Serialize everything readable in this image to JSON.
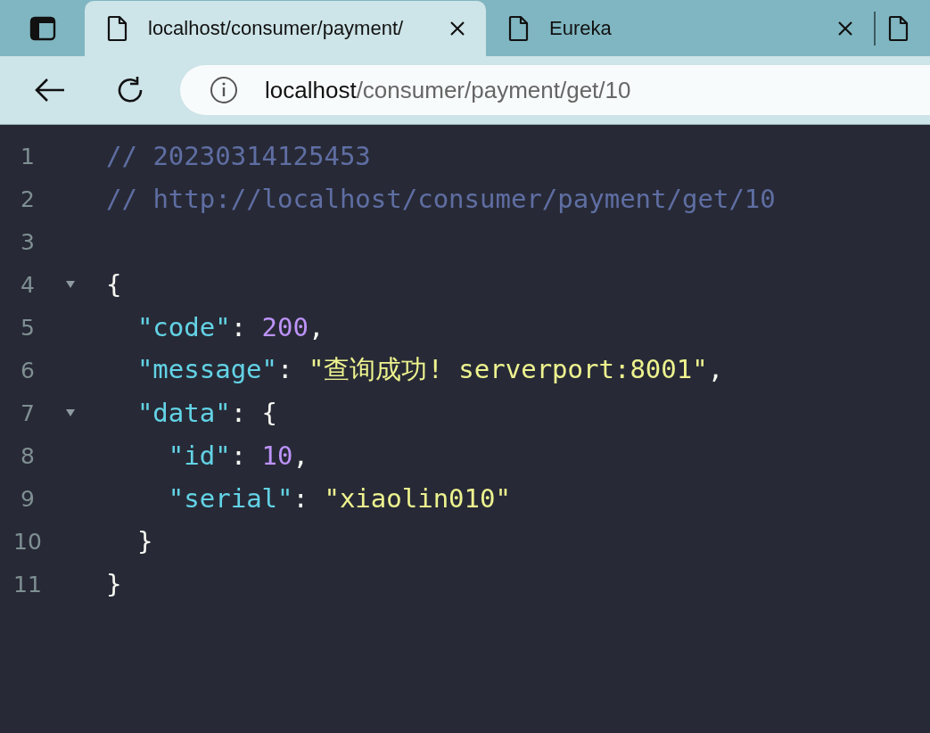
{
  "tabs": [
    {
      "title": "localhost/consumer/payment/",
      "selected": true
    },
    {
      "title": "Eureka",
      "selected": false
    },
    {
      "selected": false
    }
  ],
  "address_bar": {
    "host": "localhost",
    "path": "/consumer/payment/get/10"
  },
  "code_lines": [
    {
      "number": "1",
      "tokens": [
        {
          "kind": "comment",
          "text": "// 20230314125453"
        }
      ]
    },
    {
      "number": "2",
      "tokens": [
        {
          "kind": "comment",
          "text": "// http://localhost/consumer/payment/get/10"
        }
      ]
    },
    {
      "number": "3"
    },
    {
      "number": "4",
      "expanded": true,
      "tokens": [
        {
          "kind": "punct",
          "text": "{"
        }
      ],
      "children": [
        {
          "number": "5",
          "tokens": [
            {
              "kind": "key",
              "text": "\"code\""
            },
            {
              "kind": "punct",
              "text": ": "
            },
            {
              "kind": "number",
              "text": "200"
            },
            {
              "kind": "punct",
              "text": ","
            }
          ]
        },
        {
          "number": "6",
          "tokens": [
            {
              "kind": "key",
              "text": "\"message\""
            },
            {
              "kind": "punct",
              "text": ": "
            },
            {
              "kind": "string",
              "text": "\"查询成功! serverport:8001\""
            },
            {
              "kind": "punct",
              "text": ","
            }
          ]
        },
        {
          "number": "7",
          "expanded": true,
          "tokens": [
            {
              "kind": "key",
              "text": "\"data\""
            },
            {
              "kind": "punct",
              "text": ": {"
            }
          ],
          "children": [
            {
              "number": "8",
              "tokens": [
                {
                  "kind": "key",
                  "text": "\"id\""
                },
                {
                  "kind": "punct",
                  "text": ": "
                },
                {
                  "kind": "number",
                  "text": "10"
                },
                {
                  "kind": "punct",
                  "text": ","
                }
              ]
            },
            {
              "number": "9",
              "tokens": [
                {
                  "kind": "key",
                  "text": "\"serial\""
                },
                {
                  "kind": "punct",
                  "text": ": "
                },
                {
                  "kind": "string",
                  "text": "\"xiaolin010\""
                }
              ]
            }
          ]
        },
        {
          "number": "10",
          "tokens": [
            {
              "kind": "punct",
              "text": "}"
            }
          ]
        }
      ]
    },
    {
      "number": "11",
      "tokens": [
        {
          "kind": "punct",
          "text": "}"
        }
      ]
    }
  ]
}
